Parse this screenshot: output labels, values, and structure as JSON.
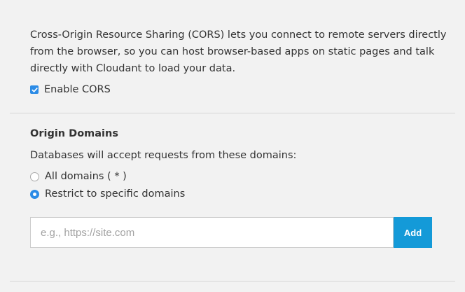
{
  "intro": {
    "text": "Cross-Origin Resource Sharing (CORS) lets you connect to remote servers directly from the browser, so you can host browser-based apps on static pages and talk directly with Cloudant to load your data."
  },
  "cors": {
    "enable_label": "Enable CORS",
    "enabled": true
  },
  "origin": {
    "title": "Origin Domains",
    "description": "Databases will accept requests from these domains:",
    "options": [
      {
        "label": "All domains ( * )",
        "selected": false
      },
      {
        "label": "Restrict to specific domains",
        "selected": true
      }
    ],
    "input_placeholder": "e.g., https://site.com",
    "input_value": "",
    "add_label": "Add"
  },
  "colors": {
    "accent": "#2b8be6",
    "button": "#149ad8",
    "background": "#f2f2f2"
  },
  "icons": {
    "checkbox": "checkmark-icon"
  }
}
